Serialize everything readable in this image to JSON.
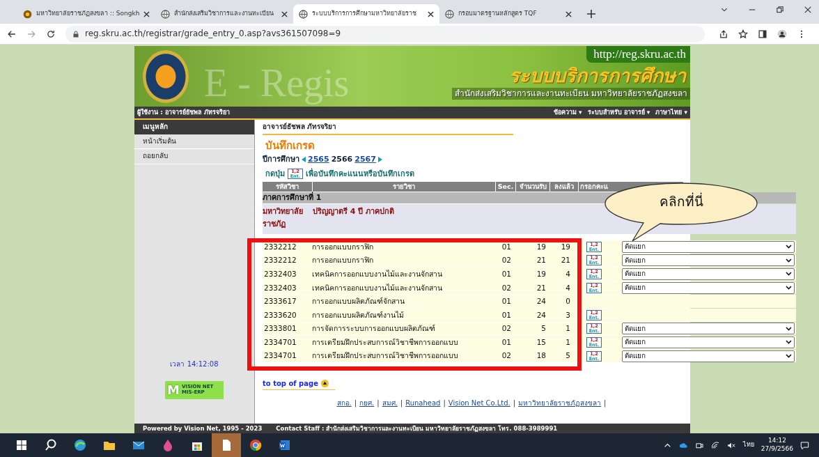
{
  "browser": {
    "tabs": [
      {
        "title": "มหาวิทยาลัยราชภัฏสงขลา :: Songkh",
        "selected": false
      },
      {
        "title": "สำนักส่งเสริมวิชาการและงานทะเบียน",
        "selected": false
      },
      {
        "title": "ระบบบริการการศึกษามหาวิทยาลัยราช",
        "selected": true
      },
      {
        "title": "กรอบมาตรฐานหลักสูตร TQF",
        "selected": false
      }
    ],
    "url": "reg.skru.ac.th/registrar/grade_entry_0.asp?avs361507098=9"
  },
  "header": {
    "site_url": "http://reg.skru.ac.th",
    "watermark": "E - Regis",
    "title": "ระบบบริการการศึกษา",
    "subtitle": "สำนักส่งเสริมวิชาการและงานทะเบียน  มหาวิทยาลัยราชภัฏสงขลา"
  },
  "navbar": {
    "user": "ผู้ใช้งาน : อาจารย์ธัชพล ภัทรจริยา",
    "menus": [
      "ข้อความ ▾",
      "ระบบสำหรับ อาจารย์ ▾",
      "ภาษาไทย ▾"
    ]
  },
  "sidebar": {
    "heading": "เมนูหลัก",
    "items": [
      "หน้าเริ่มต้น",
      "ถอยกลับ"
    ],
    "time": "เวลา 14:12:08",
    "logo": {
      "letter": "M",
      "lines": [
        "VISION NET",
        "MIS-ERP"
      ]
    }
  },
  "content": {
    "teacher": "อาจารย์ธัชพล ภัทรจริยา",
    "page_title": "บันทึกเกรด",
    "year_label": "ปีการศึกษา",
    "years": [
      {
        "label": "2565",
        "selected": false
      },
      {
        "label": "2566",
        "selected": true
      },
      {
        "label": "2567",
        "selected": false
      }
    ],
    "instruction_before": "กดปุ่ม",
    "instruction_icon": [
      "1,2",
      "Ent."
    ],
    "instruction_after": "เพื่อบันทึกคะแนนหรือบันทึกเกรด",
    "table": {
      "columns": [
        "รหัสวิชา",
        "รายวิชา",
        "Sec.",
        "จำนวนรับ",
        "ลงแล้ว",
        "กรอกคะแ"
      ],
      "semester": "ภาคการศึกษาที่ 1",
      "group": {
        "faculty": "มหาวิทยาลัย ราชภัฏ",
        "program": "ปริญญาตรี 4 ปี ภาคปกติ"
      },
      "rows": [
        {
          "code": "2332212",
          "name": "การออกแบบกราฟิก",
          "sec": "01",
          "accepted": "19",
          "enrolled": "19",
          "entry": [
            "1,2",
            "Ent."
          ],
          "mode": "ตัดแยก"
        },
        {
          "code": "2332212",
          "name": "การออกแบบกราฟิก",
          "sec": "02",
          "accepted": "21",
          "enrolled": "21",
          "entry": [
            "1,2",
            "Ent."
          ],
          "mode": "ตัดแยก"
        },
        {
          "code": "2332403",
          "name": "เทคนิคการออกแบบงานไม้และงานจักสาน",
          "sec": "01",
          "accepted": "19",
          "enrolled": "4",
          "entry": [
            "1,2",
            "Ent."
          ],
          "mode": "ตัดแยก"
        },
        {
          "code": "2332403",
          "name": "เทคนิคการออกแบบงานไม้และงานจักสาน",
          "sec": "02",
          "accepted": "21",
          "enrolled": "4",
          "entry": [
            "1,2",
            "Ent."
          ],
          "mode": "ตัดแยก"
        },
        {
          "code": "2333617",
          "name": "การออกแบบผลิตภัณฑ์จักสาน",
          "sec": "01",
          "accepted": "24",
          "enrolled": "0"
        },
        {
          "code": "2333620",
          "name": "การออกแบบผลิตภัณฑ์งานไม้",
          "sec": "01",
          "accepted": "24",
          "enrolled": "3",
          "entry": [
            "1,2",
            "Ent."
          ]
        },
        {
          "code": "2333801",
          "name": "การจัดการระบบการออกแบบผลิตภัณฑ์",
          "sec": "02",
          "accepted": "5",
          "enrolled": "1",
          "entry": [
            "1,2",
            "Ent."
          ],
          "mode": "ตัดแยก"
        },
        {
          "code": "2334701",
          "name": "การเตรียมฝึกประสบการณ์วิชาชีพการออกแบบ",
          "sec": "01",
          "accepted": "15",
          "enrolled": "1",
          "entry": [
            "1,2",
            "Ent."
          ],
          "mode": "ตัดแยก"
        },
        {
          "code": "2334701",
          "name": "การเตรียมฝึกประสบการณ์วิชาชีพการออกแบบ",
          "sec": "02",
          "accepted": "18",
          "enrolled": "5",
          "entry": [
            "1,2",
            "Ent."
          ],
          "mode": "ตัดแยก"
        }
      ]
    },
    "callout": "คลิกที่นี่",
    "top_link": "to top of page",
    "links": [
      "สกอ.",
      "กยศ.",
      "สมศ.",
      "Runahead",
      "Vision Net Co.Ltd.",
      "มหาวิทยาลัยราชภัฏสงขลา"
    ],
    "link_separator": "|"
  },
  "footer": {
    "powered": "Powered by Vision Net, 1995 - 2023",
    "contact": "Contact Staff : สำนักส่งเสริมวิชาการและงานทะเบียน มหาวิทยาลัยราชภัฏสงขลา โทร. 088-3989991"
  },
  "taskbar": {
    "language": "ไทย",
    "time": "14:12",
    "date": "27/9/2566"
  }
}
